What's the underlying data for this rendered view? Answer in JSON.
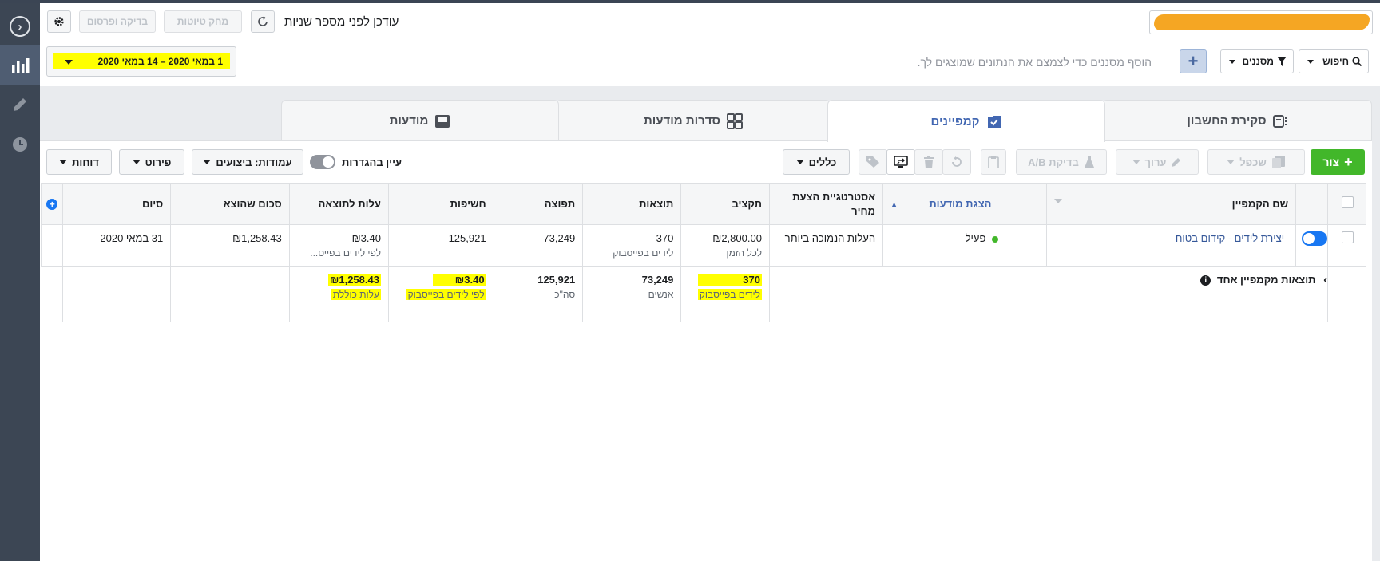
{
  "header": {
    "updated_text": "עודכן לפני מספר שניות",
    "discard_label": "מחק טיוטות",
    "review_publish_label": "בדיקה ופרסום"
  },
  "filterbar": {
    "date_range": "1 במאי 2020 – 14 במאי 2020",
    "search_label": "חיפוש",
    "filters_label": "מסננים",
    "hint": "הוסף מסננים כדי לצמצם את הנתונים שמוצגים לך."
  },
  "tabs": [
    {
      "label": "סקירת החשבון",
      "icon": "account-overview-icon",
      "active": false
    },
    {
      "label": "קמפיינים",
      "icon": "campaigns-icon",
      "active": true
    },
    {
      "label": "סדרות מודעות",
      "icon": "ad-sets-icon",
      "active": false
    },
    {
      "label": "מודעות",
      "icon": "ads-icon",
      "active": false
    }
  ],
  "toolbar": {
    "create_label": "צור",
    "duplicate_label": "שכפל",
    "edit_label": "ערוך",
    "ab_test_label": "בדיקת A/B",
    "rules_label": "כללים",
    "view_setup_label": "עיין בהגדרות",
    "columns_label": "עמודות: ביצועים",
    "breakdown_label": "פירוט",
    "reports_label": "דוחות"
  },
  "table": {
    "headers": {
      "campaign_name": "שם הקמפיין",
      "delivery": "הצגת מודעות",
      "bid_strategy": "אסטרטגיית הצעת מחיר",
      "budget": "תקציב",
      "results": "תוצאות",
      "reach": "תפוצה",
      "impressions": "חשיפות",
      "cost_per_result": "עלות לתוצאה",
      "amount_spent": "סכום שהוצא",
      "ends": "סיום"
    },
    "row": {
      "campaign_name": "יצירת לידים - קידום בטוח",
      "delivery": "פעיל",
      "bid_strategy": "העלות הנמוכה ביותר",
      "budget": "₪2,800.00",
      "budget_sub": "לכל הזמן",
      "results": "370",
      "results_sub": "לידים בפייסבוק",
      "reach": "73,249",
      "impressions": "125,921",
      "cost_per_result": "₪3.40",
      "cost_per_result_sub": "לפי לידים בפייס...",
      "amount_spent": "₪1,258.43",
      "ends": "31 במאי 2020"
    },
    "totals": {
      "label": "תוצאות מקמפיין אחד",
      "results": "370",
      "results_sub": "לידים בפייסבוק",
      "reach": "73,249",
      "reach_sub": "אנשים",
      "impressions": "125,921",
      "impressions_sub": "סה\"כ",
      "cost_per_result": "₪3.40",
      "cost_per_result_sub": "לפי לידים בפייסבוק",
      "amount_spent": "₪1,258.43",
      "amount_spent_sub": "עלות כוללת"
    }
  },
  "colors": {
    "accent": "#4267b2",
    "create_green": "#42b72a",
    "highlight": "#ffff00",
    "rail": "#3c4654"
  }
}
